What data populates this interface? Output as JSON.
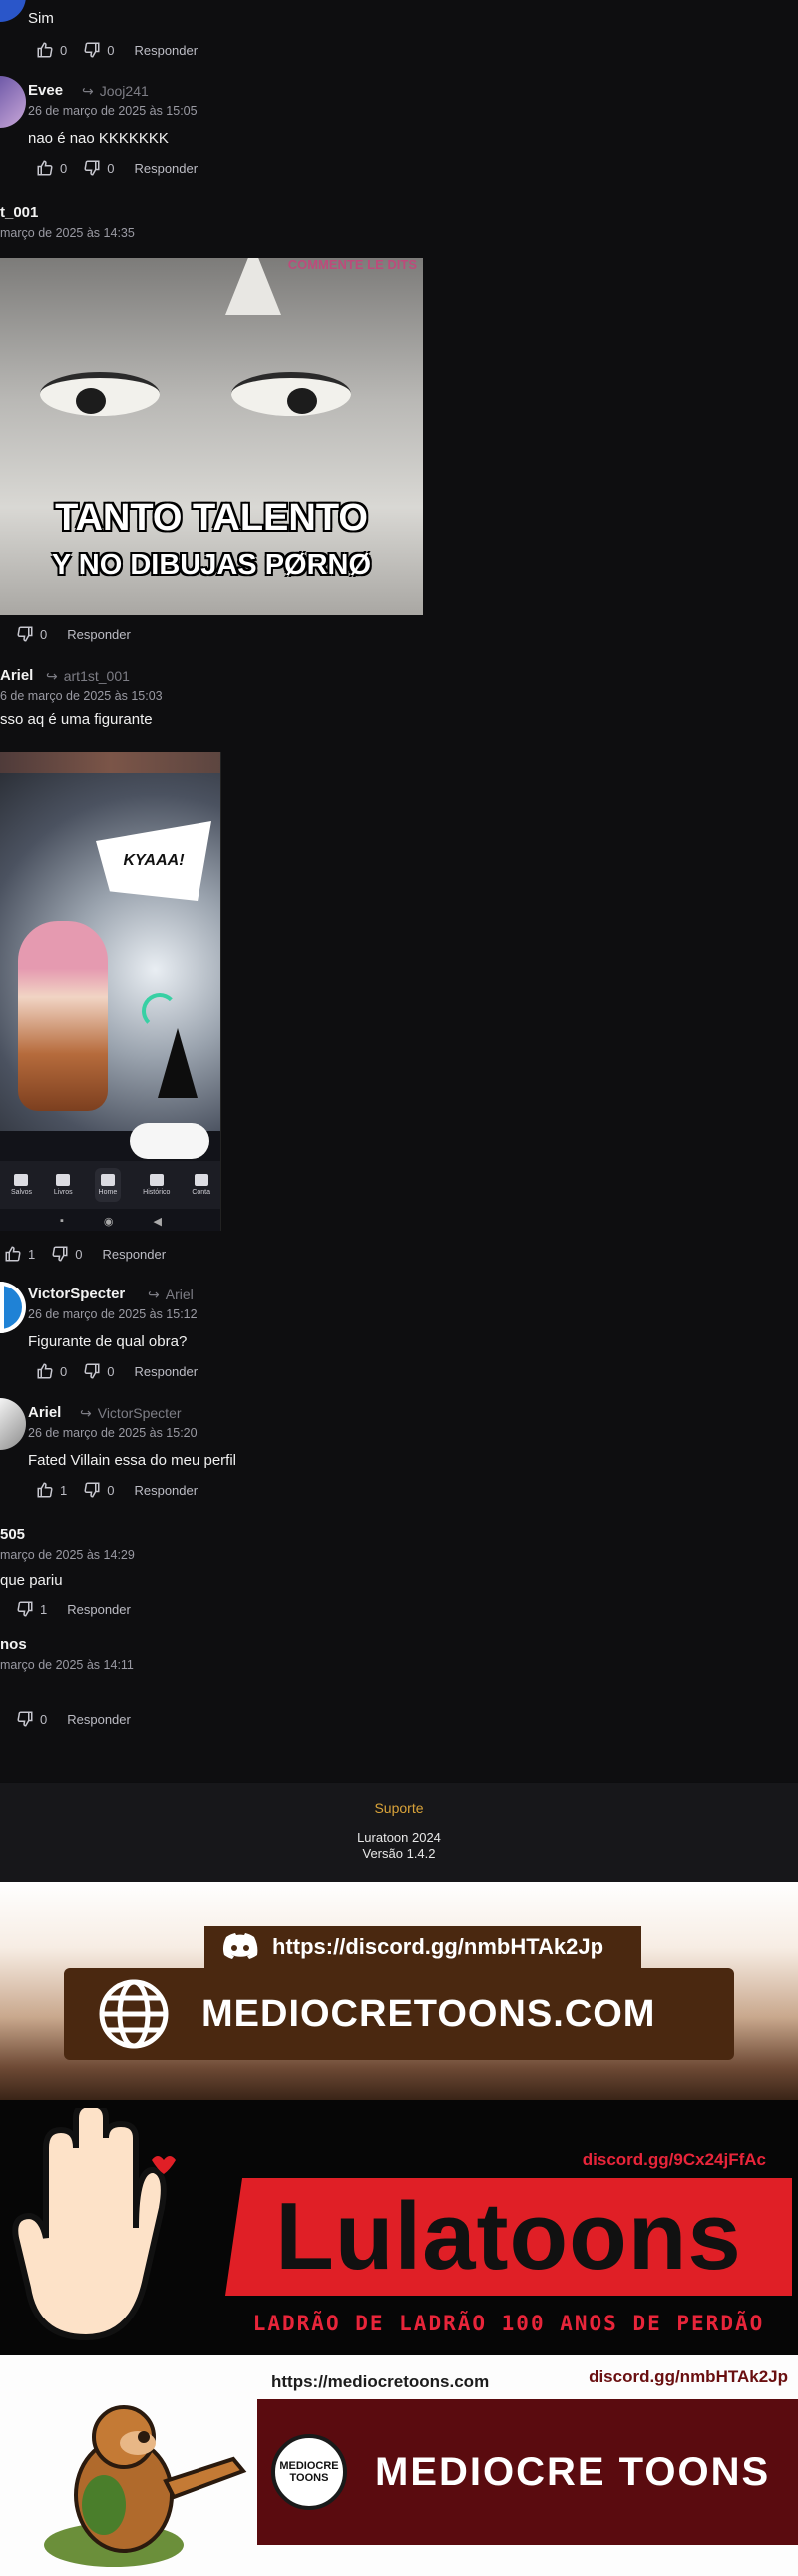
{
  "actions": {
    "reply_label": "Responder"
  },
  "comments": [
    {
      "name": "",
      "text": "Sim",
      "likes": "0",
      "dislikes": "0",
      "date": "",
      "reply_to": ""
    },
    {
      "name": "Evee",
      "reply_to": "Jooj241",
      "date": "26 de março de 2025 às 15:05",
      "text": "nao é nao KKKKKKK",
      "likes": "0",
      "dislikes": "0"
    },
    {
      "name": "t_001",
      "reply_to": "",
      "date": "março de 2025 às 14:35",
      "text": "",
      "likes": "",
      "dislikes": "0"
    },
    {
      "name": "Ariel",
      "reply_to": "art1st_001",
      "date": "6 de março de 2025 às 15:03",
      "text": "sso aq é uma figurante",
      "likes": "1",
      "dislikes": "0"
    },
    {
      "name": "VictorSpecter",
      "reply_to": "Ariel",
      "date": "26 de março de 2025 às 15:12",
      "text": "Figurante de qual obra?",
      "likes": "0",
      "dislikes": "0"
    },
    {
      "name": "Ariel",
      "reply_to": "VictorSpecter",
      "date": "26 de março de 2025 às 15:20",
      "text": "Fated Villain essa do meu perfil",
      "likes": "1",
      "dislikes": "0"
    },
    {
      "name": "505",
      "reply_to": "",
      "date": "março de 2025 às 14:29",
      "text": "que pariu",
      "likes": "",
      "dislikes": "1"
    },
    {
      "name": "nos",
      "reply_to": "",
      "date": "março de 2025 às 14:11",
      "text": "",
      "likes": "",
      "dislikes": "0"
    }
  ],
  "meme": {
    "caption_line1": "TANTO TALENTO",
    "caption_line2": "Y NO DIBUJAS PØRNØ",
    "corner_text": "COMMENTE\nLE DITS"
  },
  "screenshot": {
    "speech": "KYAAA!",
    "nav": [
      "Salvos",
      "Livros",
      "Home",
      "Histórico",
      "Conta"
    ]
  },
  "footer": {
    "support": "Suporte",
    "copyright": "Luratoon 2024",
    "version": "Versão 1.4.2"
  },
  "ad_mediocre": {
    "discord_url": "https://discord.gg/nmbHTAk2Jp",
    "domain": "MEDIOCRETOONS.COM",
    "bg_brown": "#4a2810"
  },
  "ad_lula": {
    "discord": "discord.gg/9Cx24jFfAc",
    "title": "Lulatoons",
    "subtitle": "LADRÃO DE LADRÃO 100 ANOS DE PERDÃO",
    "accent": "#e01f26"
  },
  "ad_mediocre2": {
    "url": "https://mediocretoons.com",
    "discord": "discord.gg/nmbHTAk2Jp",
    "title": "MEDIOCRE TOONS",
    "logo_text_1": "MEDIOCRE",
    "logo_text_2": "TOONS",
    "bg": "#5a0b0f"
  }
}
